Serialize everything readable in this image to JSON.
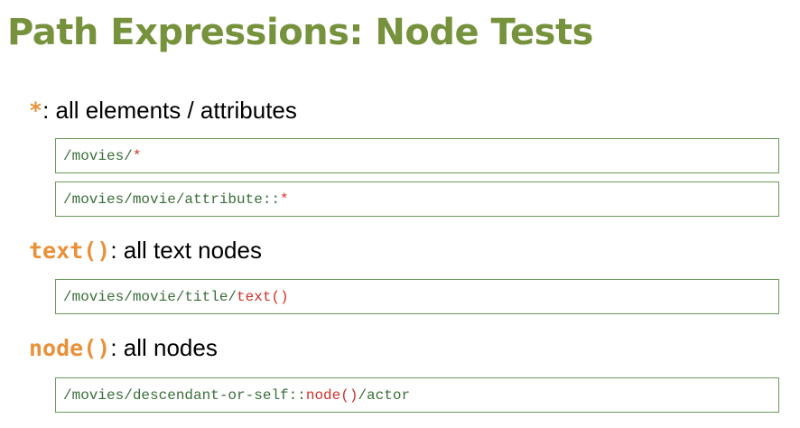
{
  "slide": {
    "title": "Path Expressions: Node Tests"
  },
  "sections": [
    {
      "token": "*",
      "separator": ":",
      "description": " all elements / attributes",
      "examples": [
        {
          "prefix": "/movies/",
          "highlight": "*",
          "suffix": ""
        },
        {
          "prefix": "/movies/movie/attribute::",
          "highlight": "*",
          "suffix": ""
        }
      ]
    },
    {
      "token": "text()",
      "separator": ":",
      "description": " all text nodes",
      "examples": [
        {
          "prefix": "/movies/movie/title/",
          "highlight": "text()",
          "suffix": ""
        }
      ]
    },
    {
      "token": "node()",
      "separator": ":",
      "description": " all nodes",
      "examples": [
        {
          "prefix": "/movies/descendant-or-self::",
          "highlight": "node()",
          "suffix": "/actor"
        }
      ]
    }
  ],
  "colors": {
    "title": "#76923c",
    "token": "#e8913a",
    "code_text": "#3a6e3a",
    "code_highlight": "#d0302a",
    "box_border": "#6a9a5a"
  }
}
